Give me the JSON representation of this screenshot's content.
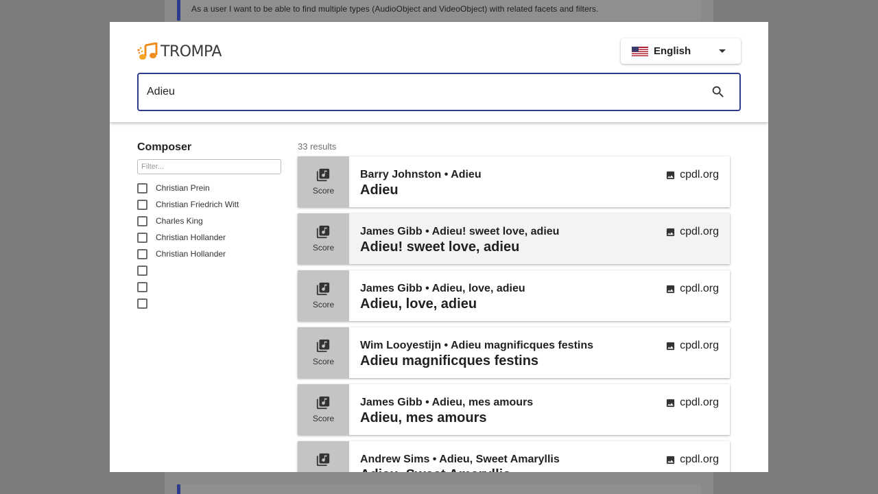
{
  "background": {
    "story_text": "As a user I want to be able to find multiple types (AudioObject and VideoObject) with related facets and filters."
  },
  "header": {
    "logo_text": "TROMPA",
    "language": {
      "selected": "English",
      "flag_icon": "us-flag-icon"
    },
    "search": {
      "value": "Adieu",
      "icon": "search-icon"
    }
  },
  "facet": {
    "title": "Composer",
    "filter_placeholder": "Filter...",
    "items": [
      {
        "label": "Christian Prein",
        "checked": false
      },
      {
        "label": "Christian Friedrich Witt",
        "checked": false
      },
      {
        "label": "Charles King",
        "checked": false
      },
      {
        "label": "Christian Hollander",
        "checked": false
      },
      {
        "label": "Christian Hollander",
        "checked": false
      },
      {
        "label": "",
        "checked": false
      },
      {
        "label": "",
        "checked": false
      },
      {
        "label": "",
        "checked": false
      }
    ]
  },
  "results": {
    "count_text": "33 results",
    "items": [
      {
        "type": "Score",
        "subtitle": "Barry Johnston • Adieu",
        "title": "Adieu",
        "source": "cpdl.org"
      },
      {
        "type": "Score",
        "subtitle": "James Gibb • Adieu! sweet love, adieu",
        "title": "Adieu! sweet love, adieu",
        "source": "cpdl.org"
      },
      {
        "type": "Score",
        "subtitle": "James Gibb • Adieu, love, adieu",
        "title": "Adieu, love, adieu",
        "source": "cpdl.org"
      },
      {
        "type": "Score",
        "subtitle": "Wim Looyestijn • Adieu magnificques festins",
        "title": "Adieu magnificques festins",
        "source": "cpdl.org"
      },
      {
        "type": "Score",
        "subtitle": "James Gibb • Adieu, mes amours",
        "title": "Adieu, mes amours",
        "source": "cpdl.org"
      },
      {
        "type": "Score",
        "subtitle": "Andrew Sims • Adieu, Sweet Amaryllis",
        "title": "Adieu, Sweet Amaryllis",
        "source": "cpdl.org"
      }
    ]
  },
  "colors": {
    "accent": "#2e3a8c",
    "logo_orange": "#f08c1e",
    "thumb_bg": "#c4c4c4"
  }
}
